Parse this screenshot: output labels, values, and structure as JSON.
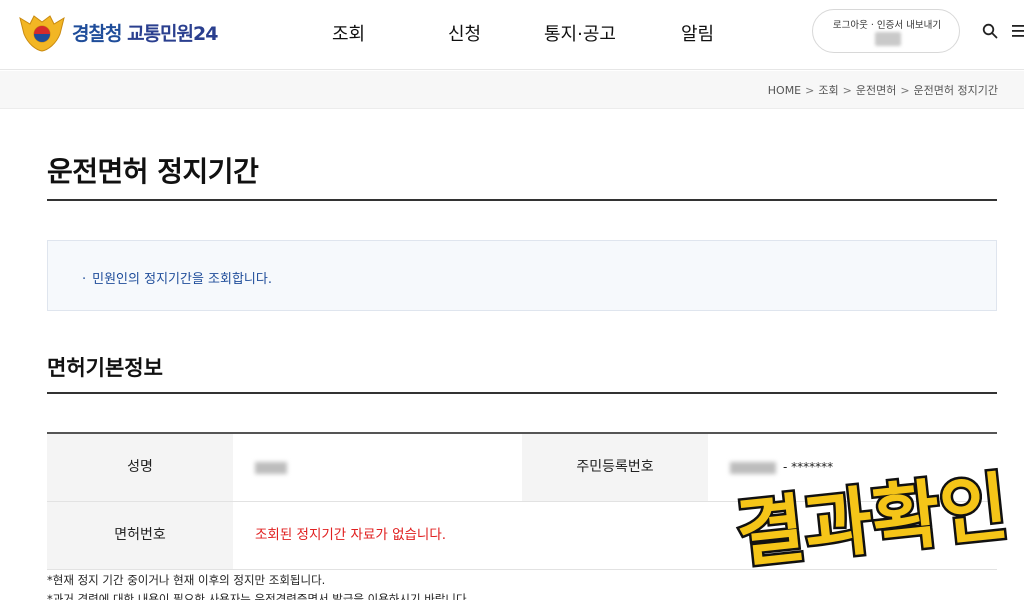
{
  "header": {
    "logo_main": "경찰청",
    "logo_sub": "교통민원24",
    "nav": [
      {
        "label": "조회"
      },
      {
        "label": "신청"
      },
      {
        "label": "통지·공고"
      },
      {
        "label": "알림"
      }
    ],
    "auth_text": "로그아웃 · 인증서 내보내기"
  },
  "breadcrumb": {
    "items": [
      "HOME",
      "조회",
      "운전면허",
      "운전면허 정지기간"
    ],
    "separator": ">"
  },
  "page": {
    "title": "운전면허 정지기간",
    "info_bullet": "·",
    "info_text": "민원인의 정지기간을 조회합니다."
  },
  "section": {
    "title": "면허기본정보"
  },
  "table": {
    "name_label": "성명",
    "rrn_label": "주민등록번호",
    "rrn_mask": "- *******",
    "license_label": "면허번호",
    "license_value": "조회된 정지기간 자료가 없습니다."
  },
  "notes": [
    "*현재 정지 기간 중이거나 현재 이후의 정지만 조회됩니다.",
    "*과거 경력에 대한 내용이 필요한 사용자는 운전경력증명서 발급을 이용하시기 바랍니다."
  ],
  "overlay": {
    "text": "결과확인"
  },
  "colors": {
    "brand_blue": "#1f4d9a",
    "error_red": "#e02020",
    "stamp_yellow": "#f5c518"
  }
}
